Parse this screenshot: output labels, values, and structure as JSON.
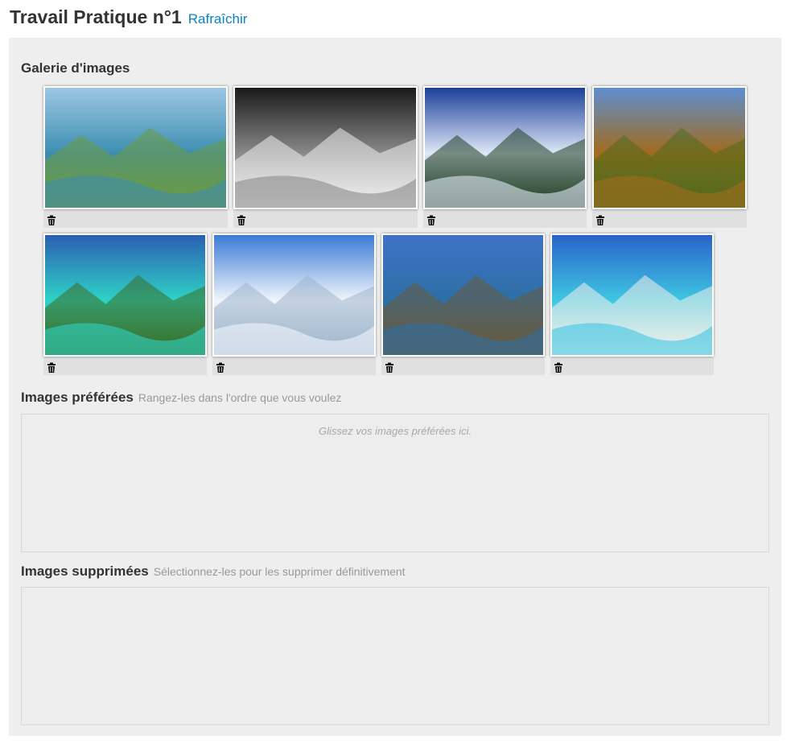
{
  "header": {
    "title": "Travail Pratique n°1",
    "refresh_link": "Rafraîchir"
  },
  "gallery": {
    "title": "Galerie d'images",
    "images": [
      {
        "subject": "coastal cliffs and sea",
        "colors": [
          "#9ec7e3",
          "#3c8eb1",
          "#6d9a3e"
        ]
      },
      {
        "subject": "frosted white trees in black and white",
        "colors": [
          "#1a1a1a",
          "#8a8a8a",
          "#f0f0f0"
        ]
      },
      {
        "subject": "snowy pine forest under blue sky",
        "colors": [
          "#1c3f9a",
          "#dfe9f7",
          "#1f3e22"
        ]
      },
      {
        "subject": "autumn forest with mountains",
        "colors": [
          "#5d8fd0",
          "#a36a1c",
          "#4e6b1e"
        ]
      },
      {
        "subject": "tropical lagoon with cliffs",
        "colors": [
          "#2b5fb3",
          "#2fd3c6",
          "#3b6d22"
        ]
      },
      {
        "subject": "snow covered trees and mountains",
        "colors": [
          "#3a7bd6",
          "#f2f6fb",
          "#9eb4cc"
        ]
      },
      {
        "subject": "mountain lake under clouds",
        "colors": [
          "#3f72c6",
          "#2d6fa5",
          "#6b5a3a"
        ]
      },
      {
        "subject": "turquoise sea and white beach",
        "colors": [
          "#2a62c9",
          "#3fc7e3",
          "#f4f1ea"
        ]
      }
    ],
    "delete_icon": "trash-icon"
  },
  "favorites": {
    "title": "Images préférées",
    "subtitle": "Rangez-les dans l'ordre que vous voulez",
    "placeholder": "Glissez vos images préférées ici."
  },
  "deleted": {
    "title": "Images supprimées",
    "subtitle": "Sélectionnez-les pour les supprimer définitivement"
  }
}
